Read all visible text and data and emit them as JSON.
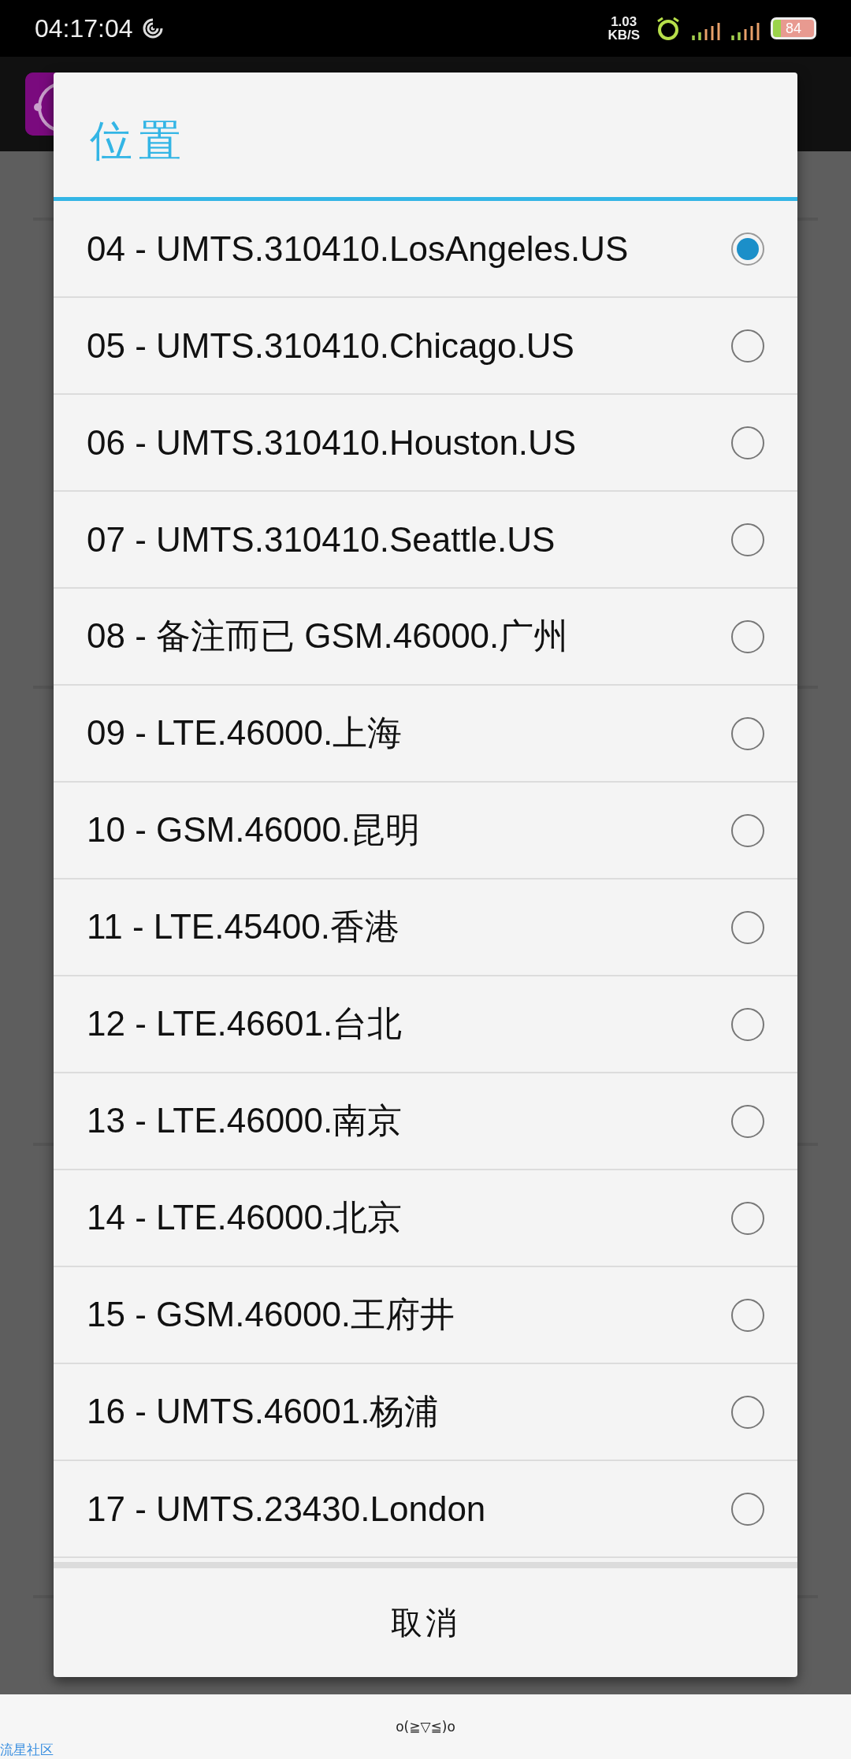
{
  "status_bar": {
    "time": "04:17:04",
    "speed_value": "1.03",
    "speed_unit": "KB/S",
    "battery": "84"
  },
  "dialog": {
    "title": "位置",
    "options": [
      {
        "label": "04 - UMTS.310410.LosAngeles.US",
        "selected": true
      },
      {
        "label": "05 - UMTS.310410.Chicago.US",
        "selected": false
      },
      {
        "label": "06 - UMTS.310410.Houston.US",
        "selected": false
      },
      {
        "label": "07 - UMTS.310410.Seattle.US",
        "selected": false
      },
      {
        "label": "08 - 备注而已 GSM.46000.广州",
        "selected": false
      },
      {
        "label": "09 - LTE.46000.上海",
        "selected": false
      },
      {
        "label": "10 - GSM.46000.昆明",
        "selected": false
      },
      {
        "label": "11 - LTE.45400.香港",
        "selected": false
      },
      {
        "label": "12 - LTE.46601.台北",
        "selected": false
      },
      {
        "label": "13 - LTE.46000.南京",
        "selected": false
      },
      {
        "label": "14 - LTE.46000.北京",
        "selected": false
      },
      {
        "label": "15 - GSM.46000.王府井",
        "selected": false
      },
      {
        "label": "16 - UMTS.46001.杨浦",
        "selected": false
      },
      {
        "label": "17 - UMTS.23430.London",
        "selected": false
      }
    ],
    "cancel": "取消"
  },
  "footer": {
    "emoticon": "o(≧▽≦)o",
    "link": "流星社区"
  }
}
